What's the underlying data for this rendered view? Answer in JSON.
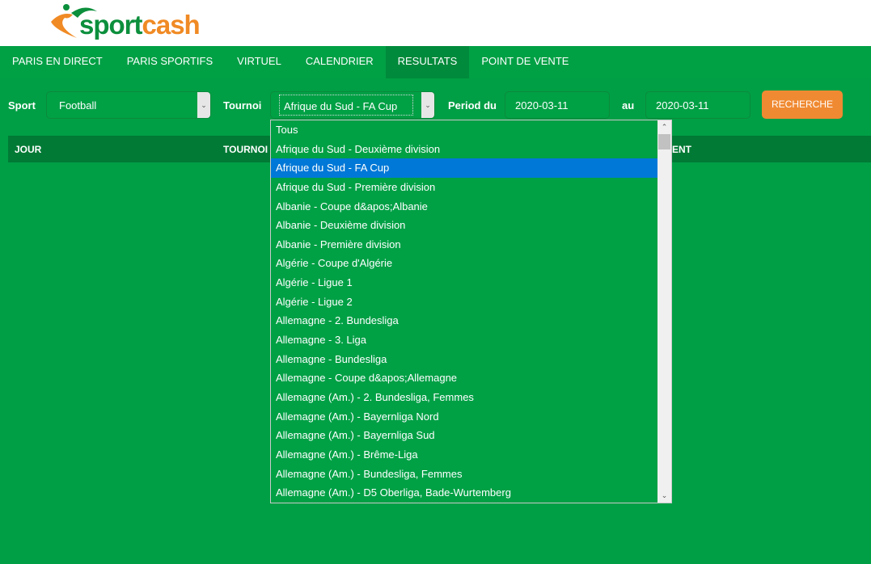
{
  "brand": {
    "logo_text_1": "sport",
    "logo_text_2": "cash"
  },
  "nav": [
    {
      "label": "PARIS EN DIRECT"
    },
    {
      "label": "PARIS SPORTIFS"
    },
    {
      "label": "VIRTUEL"
    },
    {
      "label": "CALENDRIER"
    },
    {
      "label": "RESULTATS",
      "active": true
    },
    {
      "label": "POINT DE VENTE"
    }
  ],
  "filters": {
    "sport_label": "Sport",
    "sport_value": "Football",
    "tournoi_label": "Tournoi",
    "tournoi_value": "Afrique du Sud - FA Cup",
    "period_label": "Period du",
    "date_from": "2020-03-11",
    "au_label": "au",
    "date_to": "2020-03-11",
    "search_button": "RECHERCHE"
  },
  "table": {
    "headers": [
      "JOUR",
      "TOURNOI",
      "ENT"
    ]
  },
  "dropdown": {
    "selected_index": 2,
    "options": [
      "Tous",
      "Afrique du Sud - Deuxième division",
      "Afrique du Sud - FA Cup",
      "Afrique du Sud - Première division",
      "Albanie - Coupe d&apos;Albanie",
      "Albanie - Deuxième division",
      "Albanie - Première division",
      "Algérie - Coupe d'Algérie",
      "Algérie - Ligue 1",
      "Algérie - Ligue 2",
      "Allemagne - 2. Bundesliga",
      "Allemagne - 3. Liga",
      "Allemagne - Bundesliga",
      "Allemagne - Coupe d&apos;Allemagne",
      "Allemagne (Am.) - 2. Bundesliga, Femmes",
      "Allemagne (Am.) - Bayernliga Nord",
      "Allemagne (Am.) - Bayernliga Sud",
      "Allemagne (Am.) - Brême-Liga",
      "Allemagne (Am.) - Bundesliga, Femmes",
      "Allemagne (Am.) - D5 Oberliga, Bade-Wurtemberg"
    ]
  },
  "colors": {
    "background": "#009f45",
    "header_row": "#007a35",
    "accent": "#f08a32",
    "selection": "#0078d7"
  }
}
